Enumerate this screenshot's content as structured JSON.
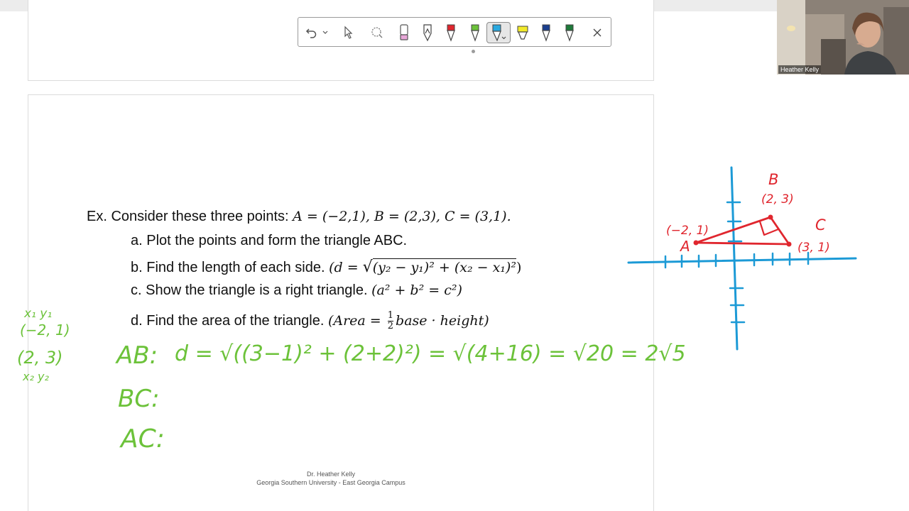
{
  "window": {
    "menu_dots": "..."
  },
  "toolbar": {
    "tools": [
      "undo-icon",
      "dropdown-arrow-icon",
      "select-cursor-icon",
      "lasso-icon",
      "eraser-icon",
      "ballpoint-pen-icon",
      "red-pen-icon",
      "green-pen-icon",
      "blue-highlighter-icon",
      "yellow-highlighter-icon",
      "dark-blue-pen-icon",
      "dark-green-pen-icon",
      "close-icon"
    ],
    "selected_tool": "blue-highlighter-icon",
    "colors": {
      "red": "#e0262e",
      "green": "#6cc23a",
      "blue": "#2aa9e0",
      "yellow": "#f2ea2a",
      "dark_blue": "#1b3f8f",
      "dark_green": "#1e7a3a"
    }
  },
  "video": {
    "participant_name": "Heather Kelly"
  },
  "problem": {
    "intro": "Ex. Consider these three points: ",
    "points_math": "A = (−2,1), B = (2,3), C = (3,1).",
    "a": "a. Plot the points and form the triangle ABC.",
    "b_text": "b. Find the length of each side. ",
    "b_math_prefix": "(d = ",
    "b_math_radicand": "(y₂ − y₁)² + (x₂ − x₁)²",
    "b_math_suffix": ")",
    "c_text": "c. Show the triangle is a right triangle. ",
    "c_math": "(a² + b² = c²)",
    "d_text": "d. Find the area of the triangle. ",
    "d_math_prefix": "(Area = ",
    "d_frac_num": "1",
    "d_frac_den": "2",
    "d_math_suffix": "base · height)"
  },
  "handwriting": {
    "color": "#6cc23a",
    "side_notes": [
      "x₁ y₁",
      "(−2, 1)",
      "(2, 3)",
      "x₂ y₂"
    ],
    "ab_label": "AB:",
    "ab_work": "d = √((3−1)² + (2+2)²) = √(4+16) = √20 = 2√5",
    "bc_label": "BC:",
    "ac_label": "AC:"
  },
  "graph": {
    "axis_color": "#1c9ad6",
    "triangle_color": "#e0262e",
    "labels": {
      "A_name": "A",
      "A_coords": "(−2, 1)",
      "B_name": "B",
      "B_coords": "(2, 3)",
      "C_name": "C",
      "C_coords": "(3, 1)"
    }
  },
  "footer": {
    "line1": "Dr. Heather Kelly",
    "line2": "Georgia Southern University - East Georgia Campus"
  }
}
